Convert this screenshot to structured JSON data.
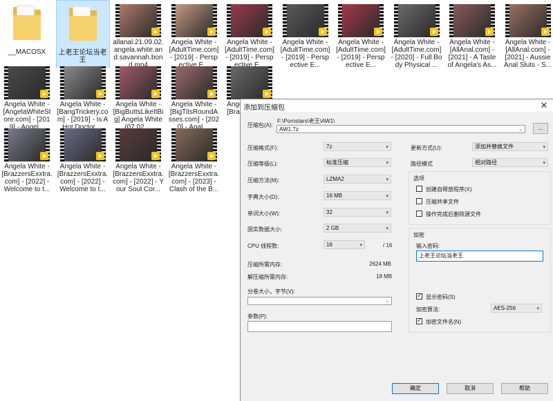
{
  "files": [
    {
      "kind": "folder",
      "label": "__MACOSX"
    },
    {
      "kind": "folder",
      "label": "上老王论坛当老王",
      "selected": true
    },
    {
      "kind": "video",
      "label": "allanal.21.09.02.angela.white.and.savannah.bond.mp4",
      "tint": "#b07a6a"
    },
    {
      "kind": "video",
      "label": "Angela White - [AdultTime.com] - [2019] - Perspective E...",
      "tint": "#c49a84"
    },
    {
      "kind": "video",
      "label": "Angela White - [AdultTime.com] - [2019] - Perspective E...",
      "tint": "#9a3a4a"
    },
    {
      "kind": "video",
      "label": "Angela White - [AdultTime.com] - [2019] - Perspective E...",
      "tint": "#5a5a5a"
    },
    {
      "kind": "video",
      "label": "Angela White - [AdultTime.com] - [2019] - Perspective E...",
      "tint": "#a33848"
    },
    {
      "kind": "video",
      "label": "Angela White - [AdultTime.com] - [2020] - Full Body Physical ...",
      "tint": "#6a6a6a"
    },
    {
      "kind": "video",
      "label": "Angela White - [AllAnal.com] - [2021] - A Taste of Angela's As...",
      "tint": "#8a5a5a"
    },
    {
      "kind": "video",
      "label": "Angela White - [AllAnal.com] - [2021] - Aussie Anal Sluts - S...",
      "tint": "#9a7060"
    },
    {
      "kind": "video",
      "label": "Angela White - [AngelaWhiteStore.com] - [2019] - Angel...",
      "tint": "#4a4a4a"
    },
    {
      "kind": "video",
      "label": "Angela White - [BangTrickery.com] - [2019] - Is A Hot Doctor ...",
      "tint": "#8a8a8a"
    },
    {
      "kind": "video",
      "label": "Angela White - [BigButtsLikeItBig] Angela White (07.02....",
      "tint": "#a05a6a"
    },
    {
      "kind": "video",
      "label": "Angela White - [BigTitsRoundAsses.com] - [2020] - Anal ...",
      "tint": "#9a6a6a"
    },
    {
      "kind": "video",
      "label": "Angela White - [Brazz...] - Blind...",
      "tint": "#6a6a6a"
    },
    {
      "kind": "video",
      "label": "Angela White - [BrazzersExxtra.com] - [2022] - Welcome to t...",
      "tint": "#7a7a8a"
    },
    {
      "kind": "video",
      "label": "Angela White - [BrazzersExxtra.com] - [2022] - Welcome to t...",
      "tint": "#6a6a8a"
    },
    {
      "kind": "video",
      "label": "Angela White - [BrazzersExxtra.com] - [2022] - Your Soul Cor...",
      "tint": "#5a3a3a"
    },
    {
      "kind": "video",
      "label": "Angela White - [BrazzersExxtra.com] - [2023] - Clash of the B...",
      "tint": "#8a6a5a"
    }
  ],
  "dialog": {
    "title": "添加到压缩包",
    "archive_label": "压缩包(A):",
    "archive_path": "F:\\Pornstars\\老王\\AW1\\",
    "archive_name": "AW1.7z",
    "browse_label": "...",
    "format_label": "压缩格式(F):",
    "format_value": "7z",
    "level_label": "压缩等级(L):",
    "level_value": "标准压缩",
    "method_label": "压缩方法(M):",
    "method_value": "LZMA2",
    "dict_label": "字典大小(D):",
    "dict_value": "16 MB",
    "word_label": "单词大小(W):",
    "word_value": "32",
    "solid_label": "固实数据大小:",
    "solid_value": "2 GB",
    "cpu_label": "CPU 线程数:",
    "cpu_value": "16",
    "cpu_total": "/ 16",
    "mem_comp_label": "压缩所需内存:",
    "mem_comp_value": "2624 MB",
    "mem_decomp_label": "解压缩所需内存:",
    "mem_decomp_value": "18 MB",
    "split_label": "分卷大小，字节(V):",
    "split_value": "",
    "params_label": "参数(P):",
    "params_value": "",
    "update_label": "更新方式(U):",
    "update_value": "添加并替换文件",
    "pathmode_label": "路径模式",
    "pathmode_value": "相对路径",
    "options_title": "选项",
    "opt_sfx": "创建自释放程序(X)",
    "opt_shared": "压缩共享文件",
    "opt_delete": "操作完成后删除源文件",
    "enc_title": "加密",
    "pwd_label": "输入密码:",
    "pwd_value": "上老王论坛当老王",
    "show_pwd": "显示密码(S)",
    "enc_method_label": "加密算法:",
    "enc_method_value": "AES-256",
    "enc_names": "加密文件名(N)",
    "ok": "确定",
    "cancel": "取消",
    "help": "帮助"
  }
}
